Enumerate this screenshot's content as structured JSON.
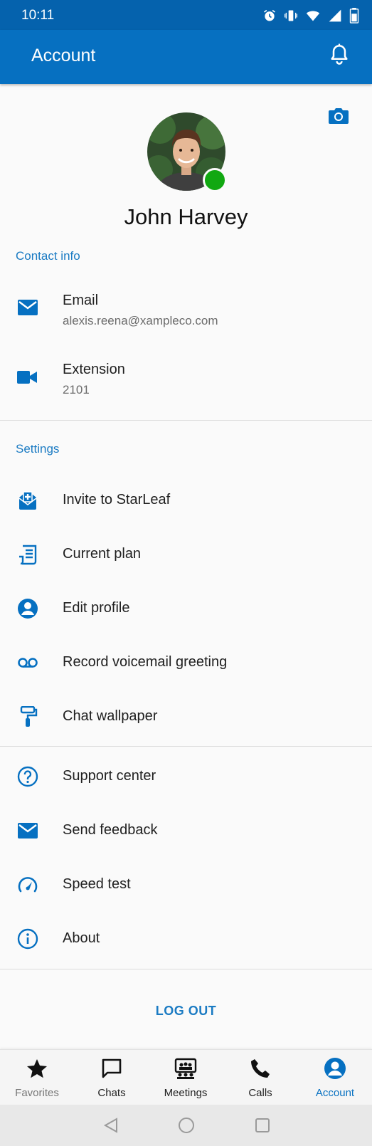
{
  "status_bar": {
    "time": "10:11"
  },
  "app_bar": {
    "title": "Account"
  },
  "profile": {
    "name": "John Harvey",
    "presence_color": "#11a811"
  },
  "contact_info": {
    "header": "Contact info",
    "items": [
      {
        "label": "Email",
        "value": "alexis.reena@xampleco.com",
        "icon": "email-icon"
      },
      {
        "label": "Extension",
        "value": "2101",
        "icon": "video-icon"
      }
    ]
  },
  "settings": {
    "header": "Settings",
    "items": [
      {
        "label": "Invite to StarLeaf",
        "icon": "invite-icon"
      },
      {
        "label": "Current plan",
        "icon": "plan-icon"
      },
      {
        "label": "Edit profile",
        "icon": "person-icon"
      },
      {
        "label": "Record voicemail greeting",
        "icon": "voicemail-icon"
      },
      {
        "label": "Chat wallpaper",
        "icon": "paint-roller-icon"
      }
    ]
  },
  "help": {
    "items": [
      {
        "label": "Support center",
        "icon": "help-icon"
      },
      {
        "label": "Send feedback",
        "icon": "email-icon"
      },
      {
        "label": "Speed test",
        "icon": "speedometer-icon"
      },
      {
        "label": "About",
        "icon": "info-icon"
      }
    ]
  },
  "logout_label": "LOG OUT",
  "bottom_nav": {
    "tabs": [
      {
        "label": "Favorites",
        "icon": "star-icon",
        "active": false
      },
      {
        "label": "Chats",
        "icon": "chat-icon",
        "active": false
      },
      {
        "label": "Meetings",
        "icon": "meetings-icon",
        "active": false
      },
      {
        "label": "Calls",
        "icon": "phone-icon",
        "active": false
      },
      {
        "label": "Account",
        "icon": "account-icon",
        "active": true
      }
    ]
  },
  "colors": {
    "accent": "#0670c1",
    "status_bar": "#0562ad",
    "link": "#1b7bc3",
    "active_tab": "#0670c1"
  }
}
